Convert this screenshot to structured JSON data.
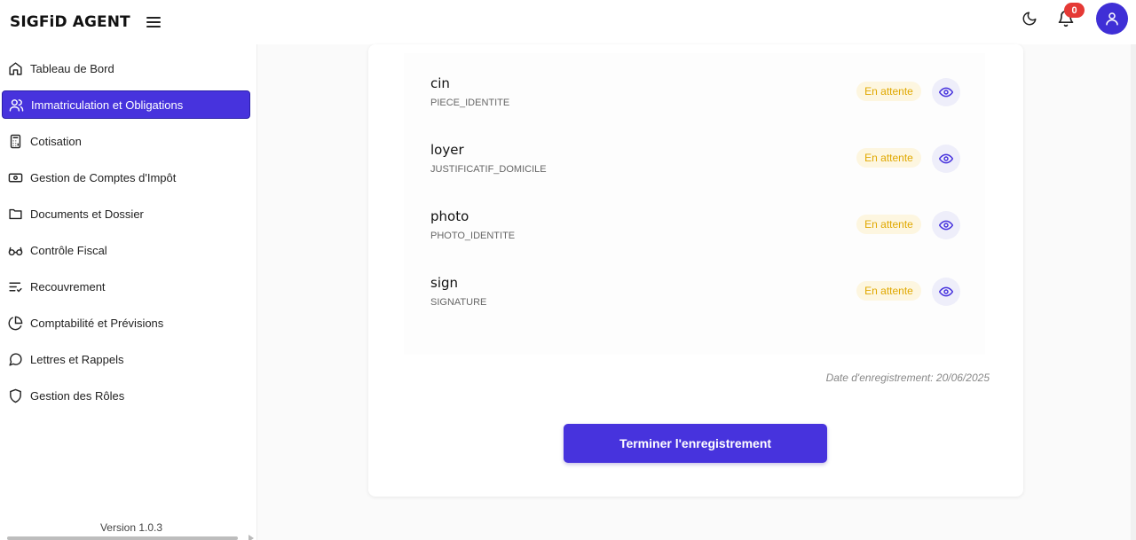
{
  "header": {
    "brand": "SIGFiD AGENT",
    "notification_count": "0"
  },
  "sidebar": {
    "items": [
      {
        "label": "Tableau de Bord",
        "icon": "home-icon"
      },
      {
        "label": "Immatriculation et Obligations",
        "icon": "users-icon"
      },
      {
        "label": "Cotisation",
        "icon": "calculator-icon"
      },
      {
        "label": "Gestion de Comptes d'Impôt",
        "icon": "banknote-icon"
      },
      {
        "label": "Documents et Dossier",
        "icon": "folder-icon"
      },
      {
        "label": "Contrôle Fiscal",
        "icon": "glasses-icon"
      },
      {
        "label": "Recouvrement",
        "icon": "list-check-icon"
      },
      {
        "label": "Comptabilité et Prévisions",
        "icon": "pie-chart-icon"
      },
      {
        "label": "Lettres et Rappels",
        "icon": "message-circle-icon"
      },
      {
        "label": "Gestion des Rôles",
        "icon": "shield-icon"
      }
    ],
    "active_index": 1,
    "version": "Version 1.0.3"
  },
  "documents": [
    {
      "name": "cin",
      "type": "PIECE_IDENTITE",
      "status": "En attente"
    },
    {
      "name": "loyer",
      "type": "JUSTIFICATIF_DOMICILE",
      "status": "En attente"
    },
    {
      "name": "photo",
      "type": "PHOTO_IDENTITE",
      "status": "En attente"
    },
    {
      "name": "sign",
      "type": "SIGNATURE",
      "status": "En attente"
    }
  ],
  "registration_date": "Date d'enregistrement: 20/06/2025",
  "submit_label": "Terminer l'enregistrement",
  "colors": {
    "primary": "#4733dd",
    "badge": "#e53935",
    "status_text": "#e0a800",
    "status_bg": "#fdf6e0"
  }
}
